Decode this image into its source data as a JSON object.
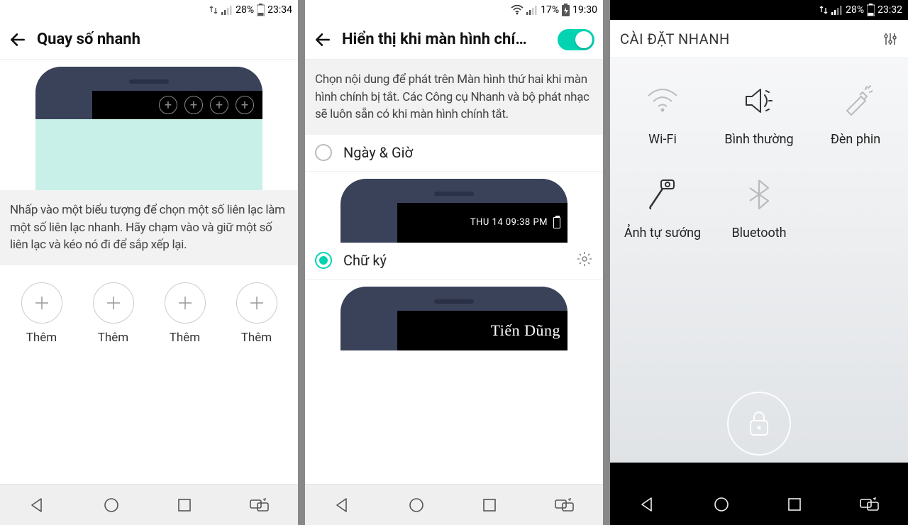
{
  "p1": {
    "status": {
      "batt": "28%",
      "time": "23:34"
    },
    "title": "Quay số nhanh",
    "help": "Nhấp vào một biểu tượng để chọn một số liên lạc làm một số liên lạc nhanh. Hãy chạm vào và giữ một số liên lạc và kéo nó đi để sắp xếp lại.",
    "add_label": "Thêm"
  },
  "p2": {
    "status": {
      "batt": "17%",
      "time": "19:30"
    },
    "title": "Hiển thị khi màn hình chí…",
    "help": "Chọn nội dung để phát trên Màn hình thứ hai khi màn hình chính bị tắt. Các Công cụ Nhanh và bộ phát nhạc sẽ luôn sẵn có khi màn hình chính tắt.",
    "opt1": "Ngày & Giờ",
    "mock1_text": "THU 14  09:38 PM",
    "opt2": "Chữ ký",
    "mock2_text": "Tiến Dũng"
  },
  "p3": {
    "status": {
      "batt": "28%",
      "time": "23:32"
    },
    "title": "CÀI ĐẶT NHANH",
    "tiles": {
      "wifi": "Wi-Fi",
      "sound": "Bình thường",
      "flash": "Đèn phin",
      "selfie": "Ảnh tự sướng",
      "bt": "Bluetooth"
    }
  }
}
